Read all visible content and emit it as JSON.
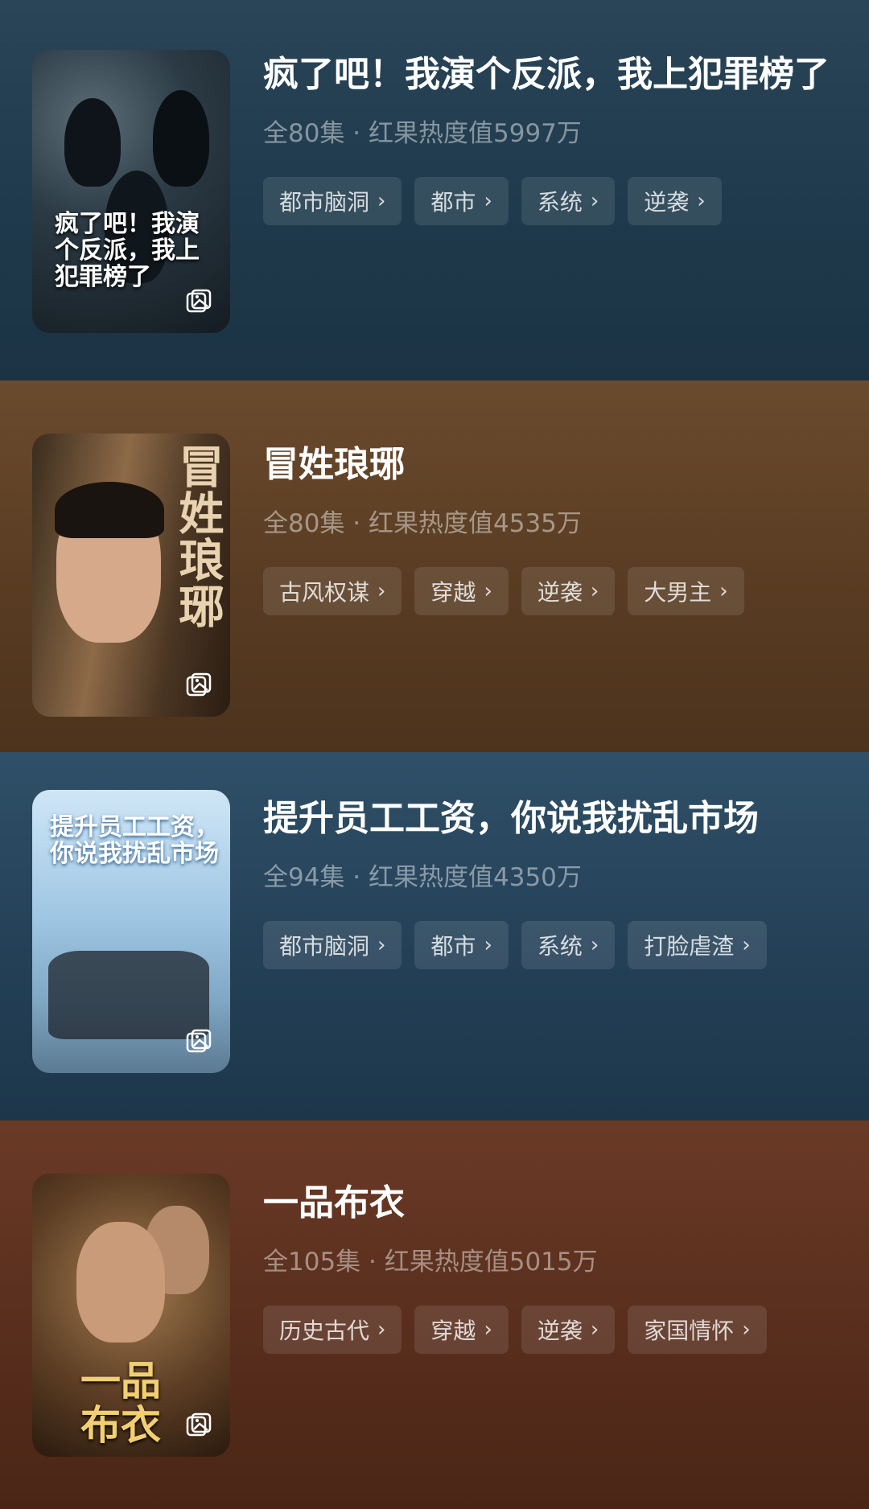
{
  "items": [
    {
      "title": "疯了吧！我演个反派，我上犯罪榜了",
      "meta": "全80集 · 红果热度值5997万",
      "poster_text": "疯了吧！我演个反派，我上犯罪榜了",
      "tags": [
        "都市脑洞",
        "都市",
        "系统",
        "逆袭"
      ]
    },
    {
      "title": "冒姓琅琊",
      "meta": "全80集 · 红果热度值4535万",
      "poster_text": "冒姓琅琊",
      "tags": [
        "古风权谋",
        "穿越",
        "逆袭",
        "大男主"
      ]
    },
    {
      "title": "提升员工工资，你说我扰乱市场",
      "meta": "全94集 · 红果热度值4350万",
      "poster_text": "提升员工工资，你说我扰乱市场",
      "tags": [
        "都市脑洞",
        "都市",
        "系统",
        "打脸虐渣"
      ]
    },
    {
      "title": "一品布衣",
      "meta": "全105集 · 红果热度值5015万",
      "poster_text": "一品布衣",
      "tags": [
        "历史古代",
        "穿越",
        "逆袭",
        "家国情怀"
      ]
    }
  ],
  "tag_chevron": "›",
  "icons": {
    "poster_corner": "image-gallery-icon",
    "tag_arrow": "chevron-right-icon"
  }
}
